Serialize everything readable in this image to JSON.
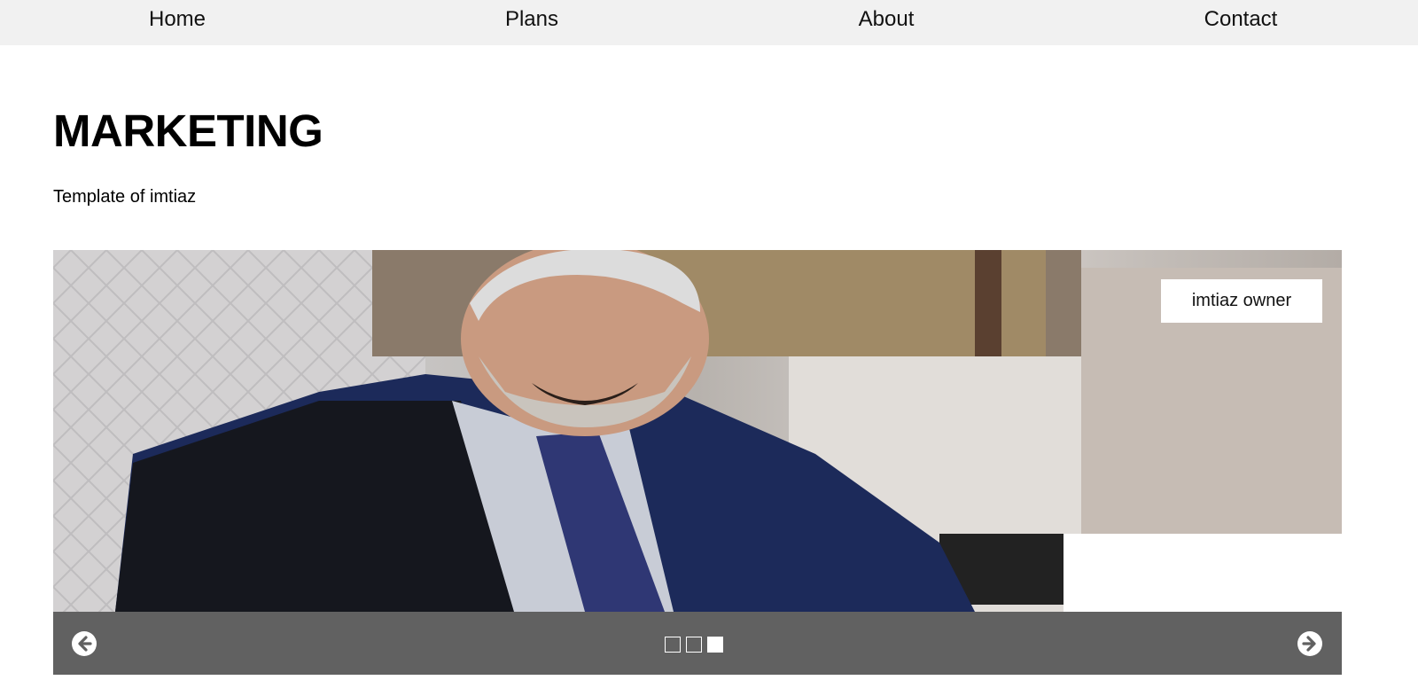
{
  "nav": {
    "items": [
      {
        "label": "Home"
      },
      {
        "label": "Plans"
      },
      {
        "label": "About"
      },
      {
        "label": "Contact"
      }
    ]
  },
  "hero": {
    "title": "MARKETING",
    "subtitle": "Template of imtiaz"
  },
  "slideshow": {
    "caption": "imtiaz owner",
    "total_slides": 3,
    "active_slide": 3,
    "prev_icon": "arrow-left-circle-icon",
    "next_icon": "arrow-right-circle-icon",
    "control_bar_color": "#616161"
  }
}
